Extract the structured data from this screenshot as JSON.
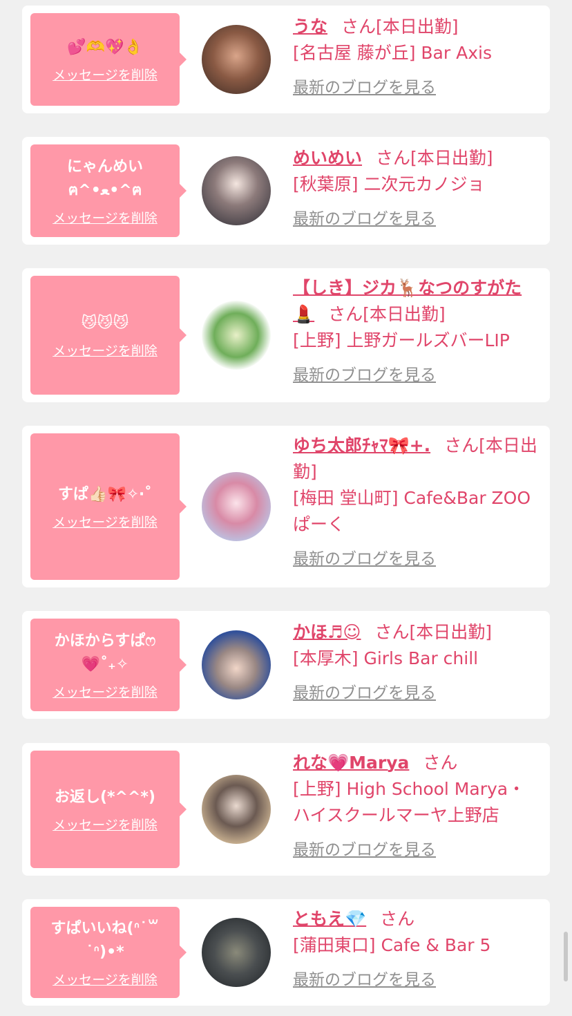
{
  "cards": [
    {
      "message": "💕🫶💖👌",
      "delete_label": "メッセージを削除",
      "name": "うな",
      "san": "さん",
      "work_status": "[本日出勤]",
      "shop": "[名古屋 藤が丘] Bar Axis",
      "blog_label": "最新のブログを見る"
    },
    {
      "message": "にゃんめい\nฅ^•ﻌ•^ฅ",
      "delete_label": "メッセージを削除",
      "name": "めいめい",
      "san": "さん",
      "work_status": "[本日出勤]",
      "shop": "[秋葉原] 二次元カノジョ",
      "blog_label": "最新のブログを見る"
    },
    {
      "message": "😼😼😼",
      "delete_label": "メッセージを削除",
      "name": "【しき】ジカ🦌なつのすがた💄",
      "san": "さん",
      "work_status": "[本日出勤]",
      "shop": "[上野] 上野ガールズバーLIP",
      "blog_label": "最新のブログを見る"
    },
    {
      "message": "すぱ👍🏻🎀✧‧˚",
      "delete_label": "メッセージを削除",
      "name": "ゆち太郎ﾁｬﾏ🎀+.",
      "san": "さん",
      "work_status": "[本日出勤]",
      "shop": "[梅田 堂山町] Cafe&Bar ZOO ぱーく",
      "blog_label": "最新のブログを見る"
    },
    {
      "message": "かほからすぱෆ\n💗˚₊✧",
      "delete_label": "メッセージを削除",
      "name": "かほ♬☺︎",
      "san": "さん",
      "work_status": "[本日出勤]",
      "shop": "[本厚木] Girls Bar chill",
      "blog_label": "最新のブログを見る"
    },
    {
      "message": "お返し(*^^*)",
      "delete_label": "メッセージを削除",
      "name": "れな💗Marya",
      "san": "さん",
      "work_status": "",
      "shop": "[上野] High School Marya・ハイスクールマーヤ上野店",
      "blog_label": "最新のブログを見る"
    },
    {
      "message": "すぱいいね(ᐢ˙꒳\n˙ᐢ)•*",
      "delete_label": "メッセージを削除",
      "name": "ともえ💎",
      "san": "さん",
      "work_status": "",
      "shop": "[蒲田東口] Cafe & Bar 5",
      "blog_label": "最新のブログを見る"
    }
  ],
  "colors": {
    "accent": "#e0456a",
    "bubble": "#ff98a8",
    "page_background": "#f0f0f0",
    "link_gray": "#909090"
  }
}
